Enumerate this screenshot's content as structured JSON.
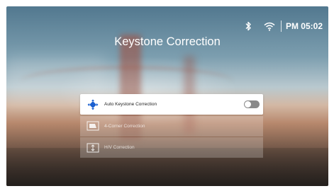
{
  "status_bar": {
    "bluetooth_icon": "bluetooth-icon",
    "wifi_icon": "wifi-icon",
    "time": "PM 05:02"
  },
  "page": {
    "title": "Keystone Correction"
  },
  "menu": {
    "items": [
      {
        "label": "Auto Keystone Correction",
        "icon": "auto-keystone-icon",
        "selected": true,
        "toggle": "off"
      },
      {
        "label": "4-Corner Correction",
        "icon": "four-corner-icon",
        "selected": false
      },
      {
        "label": "H/V Correction",
        "icon": "hv-correction-icon",
        "selected": false
      }
    ]
  },
  "colors": {
    "accent": "#1a5fd0",
    "selected_background": "#ffffff",
    "toggle_off": "#8a8a8a"
  }
}
